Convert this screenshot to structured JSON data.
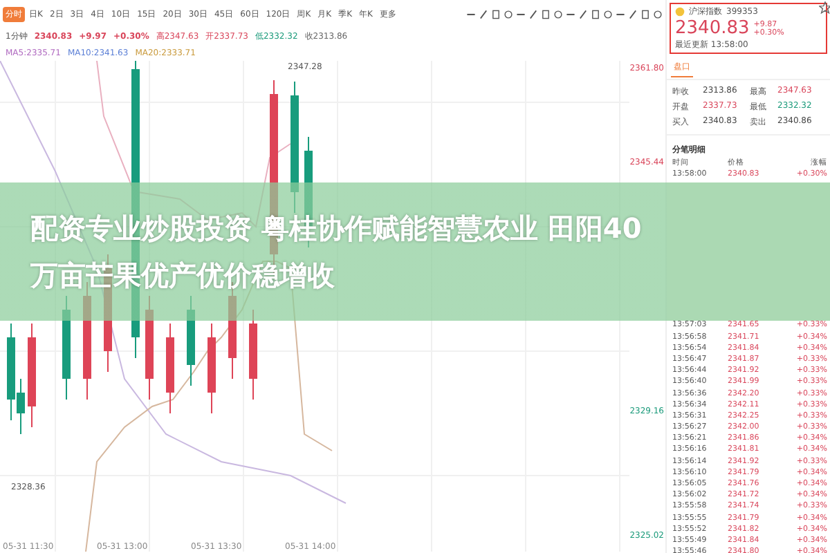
{
  "period_tabs": [
    {
      "label": "分时",
      "selected": true
    },
    {
      "label": "日K",
      "selected": false
    },
    {
      "label": "2日",
      "selected": false
    },
    {
      "label": "3日",
      "selected": false
    },
    {
      "label": "4日",
      "selected": false
    },
    {
      "label": "10日",
      "selected": false
    },
    {
      "label": "15日",
      "selected": false
    },
    {
      "label": "20日",
      "selected": false
    },
    {
      "label": "30日",
      "selected": false
    },
    {
      "label": "45日",
      "selected": false
    },
    {
      "label": "60日",
      "selected": false
    },
    {
      "label": "120日",
      "selected": false
    },
    {
      "label": "周K",
      "selected": false
    },
    {
      "label": "月K",
      "selected": false
    },
    {
      "label": "季K",
      "selected": false
    },
    {
      "label": "年K",
      "selected": false
    },
    {
      "label": "更多",
      "selected": false
    }
  ],
  "quote_line": {
    "period": "1分钟",
    "price": "2340.83",
    "change": "+9.97",
    "percent": "+0.30%",
    "stats": [
      {
        "text": "高2347.63",
        "color": "#d9455a"
      },
      {
        "text": "开2337.73",
        "color": "#d9455a"
      },
      {
        "text": "低2332.32",
        "color": "#1a9a7a"
      },
      {
        "text": "收2313.86",
        "color": "#666666"
      }
    ]
  },
  "ma_line": [
    {
      "text": "MA5:2335.71",
      "color": "#b06ac0"
    },
    {
      "text": "MA10:2341.63",
      "color": "#5b7fd6"
    },
    {
      "text": "MA20:2333.71",
      "color": "#c99a3c"
    }
  ],
  "chart": {
    "high_label": "2347.28",
    "low_label": "2328.36",
    "axis_labels": [
      {
        "text": "2361.80",
        "color": "#d9455a"
      },
      {
        "text": "2345.44",
        "color": "#d9455a"
      },
      {
        "text": "2329.16",
        "color": "#1a9a7a"
      },
      {
        "text": "2325.02",
        "color": "#1a9a7a"
      }
    ],
    "time_labels": [
      "05-31 11:30",
      "05-31 13:00",
      "05-31 13:30",
      "05-31 14:00"
    ]
  },
  "quote_panel": {
    "name": "沪深指数",
    "code": "399353",
    "price": "2340.83",
    "change": "+9.87",
    "percent": "+0.30%",
    "subtitle": "最近更新 13:58:00",
    "tab": {
      "label": "盘口",
      "selected": true
    },
    "stats": [
      {
        "label": "昨收",
        "value": "2313.86",
        "color": "#444444"
      },
      {
        "label": "最高",
        "value": "2347.63",
        "color": "#d9455a"
      },
      {
        "label": "开盘",
        "value": "2337.73",
        "color": "#d9455a"
      },
      {
        "label": "最低",
        "value": "2332.32",
        "color": "#1a9a7a"
      },
      {
        "label": "买入",
        "value": "2340.83",
        "color": "#444444"
      },
      {
        "label": "卖出",
        "value": "2340.86",
        "color": "#444444"
      }
    ]
  },
  "trades": {
    "title": "分笔明细",
    "columns": [
      "时间",
      "价格",
      "涨幅"
    ],
    "rows": [
      [
        "13:58:00",
        "2340.83",
        "+0.30%"
      ],
      [
        "13:57:03",
        "2341.65",
        "+0.33%"
      ],
      [
        "13:56:58",
        "2341.71",
        "+0.34%"
      ],
      [
        "13:56:54",
        "2341.84",
        "+0.34%"
      ],
      [
        "13:56:47",
        "2341.87",
        "+0.33%"
      ],
      [
        "13:56:44",
        "2341.92",
        "+0.33%"
      ],
      [
        "13:56:40",
        "2341.99",
        "+0.33%"
      ],
      [
        "13:56:36",
        "2342.20",
        "+0.33%"
      ],
      [
        "13:56:34",
        "2342.11",
        "+0.33%"
      ],
      [
        "13:56:31",
        "2342.25",
        "+0.33%"
      ],
      [
        "13:56:27",
        "2342.00",
        "+0.33%"
      ],
      [
        "13:56:21",
        "2341.86",
        "+0.34%"
      ],
      [
        "13:56:16",
        "2341.81",
        "+0.34%"
      ],
      [
        "13:56:14",
        "2341.92",
        "+0.33%"
      ],
      [
        "13:56:10",
        "2341.79",
        "+0.34%"
      ],
      [
        "13:56:05",
        "2341.76",
        "+0.34%"
      ],
      [
        "13:56:02",
        "2341.72",
        "+0.34%"
      ],
      [
        "13:55:58",
        "2341.74",
        "+0.33%"
      ],
      [
        "13:55:55",
        "2341.79",
        "+0.34%"
      ],
      [
        "13:55:52",
        "2341.82",
        "+0.34%"
      ],
      [
        "13:55:49",
        "2341.84",
        "+0.34%"
      ],
      [
        "13:55:46",
        "2341.80",
        "+0.34%"
      ]
    ]
  },
  "banner": {
    "headline": "配资专业炒股投资 粤桂协作赋能智慧农业 田阳40万亩芒果优产优价稳增收"
  }
}
